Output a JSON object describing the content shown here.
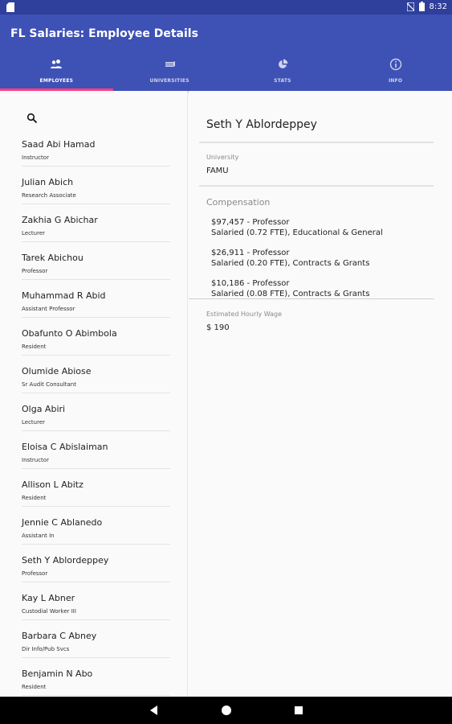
{
  "status_bar": {
    "time": "8:32"
  },
  "app": {
    "title": "FL Salaries: Employee Details"
  },
  "tabs": [
    {
      "label": "EMPLOYEES",
      "icon": "people-icon",
      "active": true
    },
    {
      "label": "UNIVERSITIES",
      "icon": "school-icon",
      "active": false
    },
    {
      "label": "STATS",
      "icon": "pie-chart-icon",
      "active": false
    },
    {
      "label": "INFO",
      "icon": "info-icon",
      "active": false
    }
  ],
  "employees": [
    {
      "name": "Saad Abi Hamad",
      "title": "Instructor"
    },
    {
      "name": "Julian Abich",
      "title": "Research Associate"
    },
    {
      "name": "Zakhia G Abichar",
      "title": "Lecturer"
    },
    {
      "name": "Tarek Abichou",
      "title": "Professor"
    },
    {
      "name": "Muhammad R Abid",
      "title": "Assistant Professor"
    },
    {
      "name": "Obafunto O Abimbola",
      "title": "Resident"
    },
    {
      "name": "Olumide Abiose",
      "title": "Sr Audit Consultant"
    },
    {
      "name": "Olga Abiri",
      "title": "Lecturer"
    },
    {
      "name": "Eloisa C Abislaiman",
      "title": "Instructor"
    },
    {
      "name": "Allison L Abitz",
      "title": "Resident"
    },
    {
      "name": "Jennie C Ablanedo",
      "title": "Assistant In"
    },
    {
      "name": "Seth Y Ablordeppey",
      "title": "Professor"
    },
    {
      "name": "Kay L Abner",
      "title": "Custodial Worker III"
    },
    {
      "name": "Barbara C Abney",
      "title": "Dir Info/Pub Svcs"
    },
    {
      "name": "Benjamin N Abo",
      "title": "Resident"
    }
  ],
  "detail": {
    "name": "Seth Y Ablordeppey",
    "university_label": "University",
    "university": "FAMU",
    "compensation_label": "Compensation",
    "compensation": [
      {
        "line1": "$97,457 - Professor",
        "line2": "Salaried (0.72 FTE), Educational & General"
      },
      {
        "line1": "$26,911 - Professor",
        "line2": "Salaried (0.20 FTE), Contracts & Grants"
      },
      {
        "line1": "$10,186 - Professor",
        "line2": "Salaried (0.08 FTE), Contracts & Grants"
      }
    ],
    "hourly_label": "Estimated Hourly Wage",
    "hourly": "$ 190"
  },
  "colors": {
    "primary": "#3e51b5",
    "primary_dark": "#2f3f9c",
    "accent": "#ff4081"
  }
}
